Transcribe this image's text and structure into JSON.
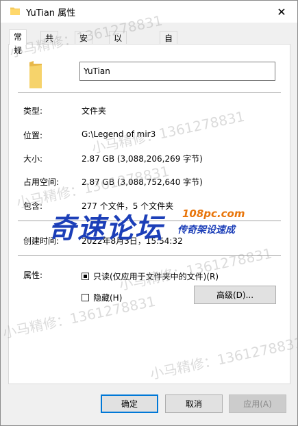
{
  "window": {
    "title": "YuTian 属性",
    "close_icon": "close-icon"
  },
  "tabs": [
    {
      "label": "常规",
      "active": true
    },
    {
      "label": "共享",
      "active": false
    },
    {
      "label": "安全",
      "active": false
    },
    {
      "label": "以前的版本",
      "active": false
    },
    {
      "label": "自定义",
      "active": false
    }
  ],
  "general": {
    "folder_name": "YuTian",
    "type_label": "类型:",
    "type_value": "文件夹",
    "location_label": "位置:",
    "location_value": "G:\\Legend of mir3",
    "size_label": "大小:",
    "size_value": "2.87 GB (3,088,206,269 字节)",
    "size_on_disk_label": "占用空间:",
    "size_on_disk_value": "2.87 GB (3,088,752,640 字节)",
    "contains_label": "包含:",
    "contains_value": "277 个文件，5 个文件夹",
    "created_label": "创建时间:",
    "created_value": "2022年8月3日，15:54:32",
    "attributes_label": "属性:",
    "readonly_label": "只读(仅应用于文件夹中的文件)(R)",
    "readonly_state": "indeterminate",
    "hidden_label": "隐藏(H)",
    "hidden_state": "unchecked",
    "advanced_button": "高级(D)..."
  },
  "footer": {
    "ok": "确定",
    "cancel": "取消",
    "apply": "应用(A)"
  },
  "overlay": {
    "watermark_text": "小马精修：1361278831",
    "logo_main": "奇速论坛",
    "logo_url": "108pc.com",
    "logo_sub": "传奇架设速成"
  },
  "colors": {
    "accent": "#0078d7",
    "folder": "#f4c95b",
    "logo_blue": "#1c3fb8",
    "logo_orange": "#e8750a"
  }
}
